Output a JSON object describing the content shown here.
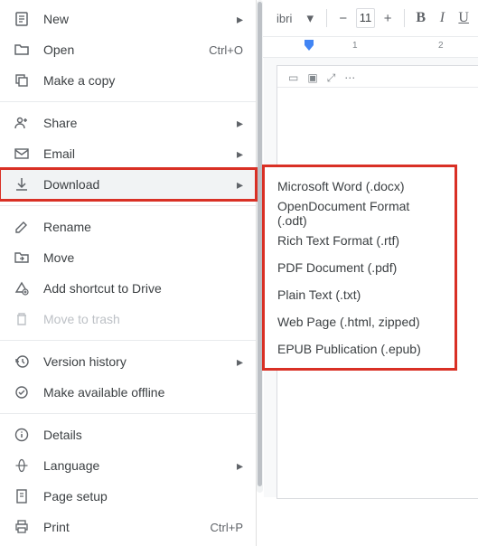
{
  "toolbar": {
    "font_name": "ibri",
    "font_size": "11",
    "bold": "B",
    "italic": "I",
    "underline": "U"
  },
  "ruler": {
    "marks": [
      "1",
      "2"
    ]
  },
  "menu": {
    "new": "New",
    "open": "Open",
    "open_shortcut": "Ctrl+O",
    "make_copy": "Make a copy",
    "share": "Share",
    "email": "Email",
    "download": "Download",
    "rename": "Rename",
    "move": "Move",
    "add_shortcut": "Add shortcut to Drive",
    "trash": "Move to trash",
    "version_history": "Version history",
    "offline": "Make available offline",
    "details": "Details",
    "language": "Language",
    "page_setup": "Page setup",
    "print": "Print",
    "print_shortcut": "Ctrl+P"
  },
  "submenu": {
    "items": [
      "Microsoft Word (.docx)",
      "OpenDocument Format (.odt)",
      "Rich Text Format (.rtf)",
      "PDF Document (.pdf)",
      "Plain Text (.txt)",
      "Web Page (.html, zipped)",
      "EPUB Publication (.epub)"
    ]
  }
}
